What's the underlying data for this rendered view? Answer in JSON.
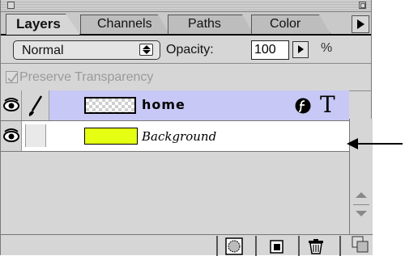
{
  "palette": {
    "tabs": [
      "Layers",
      "Channels",
      "Paths",
      "Color"
    ],
    "active_tab": "Layers"
  },
  "controls": {
    "blend_mode": "Normal",
    "opacity_label": "Opacity:",
    "opacity_value": "100",
    "opacity_unit": "%"
  },
  "preserve_transparency": {
    "label": "Preserve Transparency",
    "checked": true,
    "enabled": false
  },
  "layers": [
    {
      "name": "home",
      "visible": true,
      "selected": true,
      "thumbnail": "transparent-checker",
      "icons": [
        "effects-icon",
        "type-layer-icon"
      ],
      "type_glyph": "T"
    },
    {
      "name": "Background",
      "visible": true,
      "selected": false,
      "thumbnail_color": "#e4ff12",
      "icons": []
    }
  ],
  "footer": {
    "buttons": [
      "add-layer-mask-icon",
      "new-layer-icon",
      "trash-icon"
    ]
  },
  "annotation": {
    "arrow": "callout-arrow pointing to type layer icon"
  }
}
